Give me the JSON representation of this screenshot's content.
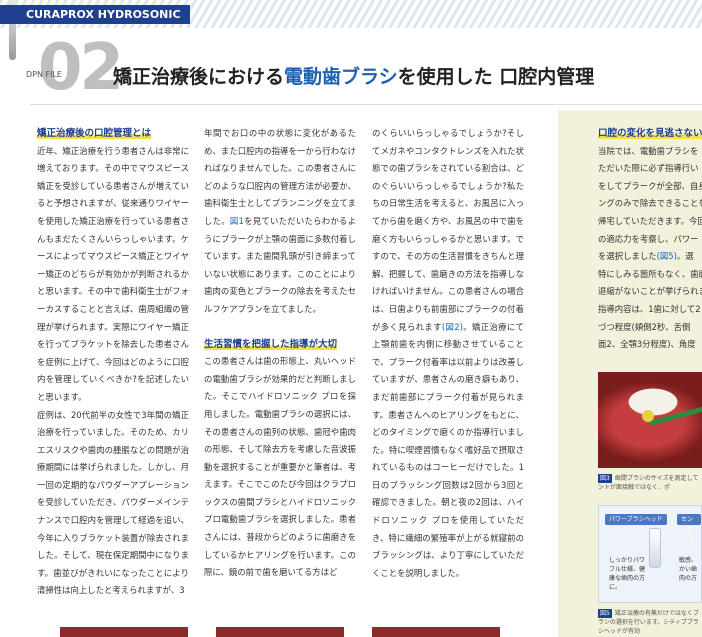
{
  "header": {
    "brand": "CURAPROX HYDROSONIC PRO",
    "dpn_file": "DPN FILE",
    "issue_number": "02",
    "title_before": "矯正治療後における",
    "title_highlight": "電動歯ブラシ",
    "title_after": "を使用した 口腔内管理"
  },
  "columns": {
    "col1": {
      "heading": "矯正治療後の口腔管理とは",
      "p1": "近年、矯正治療を行う患者さんは非常に増えております。その中でマウスピース矯正を受診している患者さんが増えていると予想されますが、従来通りワイヤーを使用した矯正治療を行っている患者さんもまだたくさんいらっしゃいます。ケースによってマウスピース矯正とワイヤー矯正のどちらが有効かが判断されるかと思います。その中で歯科衛生士がフォーカスすることと言えば、歯周組織の管理が挙げられます。実際にワイヤー矯正を行ってブラケットを除去した患者さんを症例に上げて、今回はどのように口腔内を管理していくべきか?を記述したいと思います。",
      "p2": "症例は、20代前半の女性で3年間の矯正治療を行っていました。そのため、カリエスリスクや歯肉の腫脹などの問題が治療期間には挙げられました。しかし、月一回の定期的なパウダーアプレーションを受診していただき、パウダーメインテナンスで口腔内を管理して経過を追い、今年に入りブラケット装置が除去されました。そして、現在保定期間中になります。歯並びがきれいになったことにより清掃性は向上したと考えられますが、3"
    },
    "col2": {
      "p1_before": "年間でお口の中の状態に変化があるため、また口腔内の指導を一から行わなければなりませんでした。この患者さんにどのような口腔内の管理方法が必要か、歯科衛生士としてプランニングを立てました。",
      "fig_ref": "図1",
      "p1_after": "を見ていただいたらわかるようにプラークが上顎の歯面に多数付着しています。また歯間乳頭が引き締まっていない状態にあります。このことにより歯肉の変色とプラークの除去を考えたセルフケアプランを立てました。",
      "heading": "生活習慣を把握した指導が大切",
      "p2": "この患者さんは歯の形態上、丸いヘッドの電動歯ブラシが効果的だと判断しました。そこでハイドロソニック プロを採用しました。電動歯ブラシの選択には、その患者さんの歯列の状態、歯冠や歯肉の形態、そして除去方を考慮した音波振動を選択することが重要かと筆者は、考えます。そこでこのたび今回はクラプロックスの歯間ブラシとハイドロソニック プロ電動歯ブラシを選択しました。患者さんには、普段からどのように歯磨きをしているかヒアリングを行います。この際に、鏡の前で歯を磨いてる方はど"
    },
    "col3": {
      "p1_before": "のくらいいらっしゃるでしょうか?そしてメガネやコンタクトレンズを入れた状態での歯ブラシをされている割合は、どのぐらいいらっしゃるでしょうか?私たちの日常生活を考えると、お風呂に入ってから歯を磨く方や、お風呂の中で歯を磨く方もいらっしゃるかと思います。ですので、その方の生活習慣をきちんと理解、把握して、歯磨きの方法を指導しなければいけません。この患者さんの場合は、日歯よりも前歯部にプラークの付着が多く見られます",
      "fig_ref": "(図2)",
      "p1_after": "。矯正治療にて上顎前歯を内側に移動させていることで、プラーク付着率は以前よりは改善していますが、患者さんの磨き癖もあり、まだ前歯部にプラーク付着が見られます。患者さんへのヒアリングをもとに、どのタイミングで磨くのか指導行いました。特に喫煙習慣もなく嗜好品で摂取されているものはコーヒーだけでした。1日のブラッシング回数は2回から3回と確認できました。朝と夜の2回は、ハイドロソニック プロを使用していただき、特に繊細の繁殖率が上がる就寝前のブラッシングは、より丁寧にしていただくことを説明しました。"
    },
    "col4": {
      "heading": "口腔の変化を見逃さない",
      "lines": [
        "当院では、電動歯ブラシを",
        "ただいた際に必ず指導行い",
        "をしてプラークが全部、自身",
        "ングのみで除去できることを",
        "帰宅していただきます。今回",
        "の適応力を考察し、パワー",
        "を選択しました(図5)。選",
        "特にしみる箇所もなく、歯磨",
        "退縮がないことが挙げられま",
        "指導内容は、1歯に対して2",
        "づつ程度(頬側2秒、舌側",
        "面2、全顎3分程度)、角度"
      ],
      "fig_ref_in_line": "(図5)"
    }
  },
  "figures": {
    "fig3": {
      "number": "図3",
      "caption": "歯間ブラシのサイズを測定してントが面接触ではなく、ポ"
    },
    "product": {
      "tag1": "パワーブラシヘッド",
      "tag2": "センシティブ",
      "text1": "しっかりパワフル仕様、健康な歯肉の方に。",
      "text2": "敏感、かい歯肉の方"
    },
    "fig5": {
      "number": "図5",
      "caption": "矯正治療の有無だけではなくブラシの選択を行います。シティブブラシヘッドが有効"
    }
  }
}
